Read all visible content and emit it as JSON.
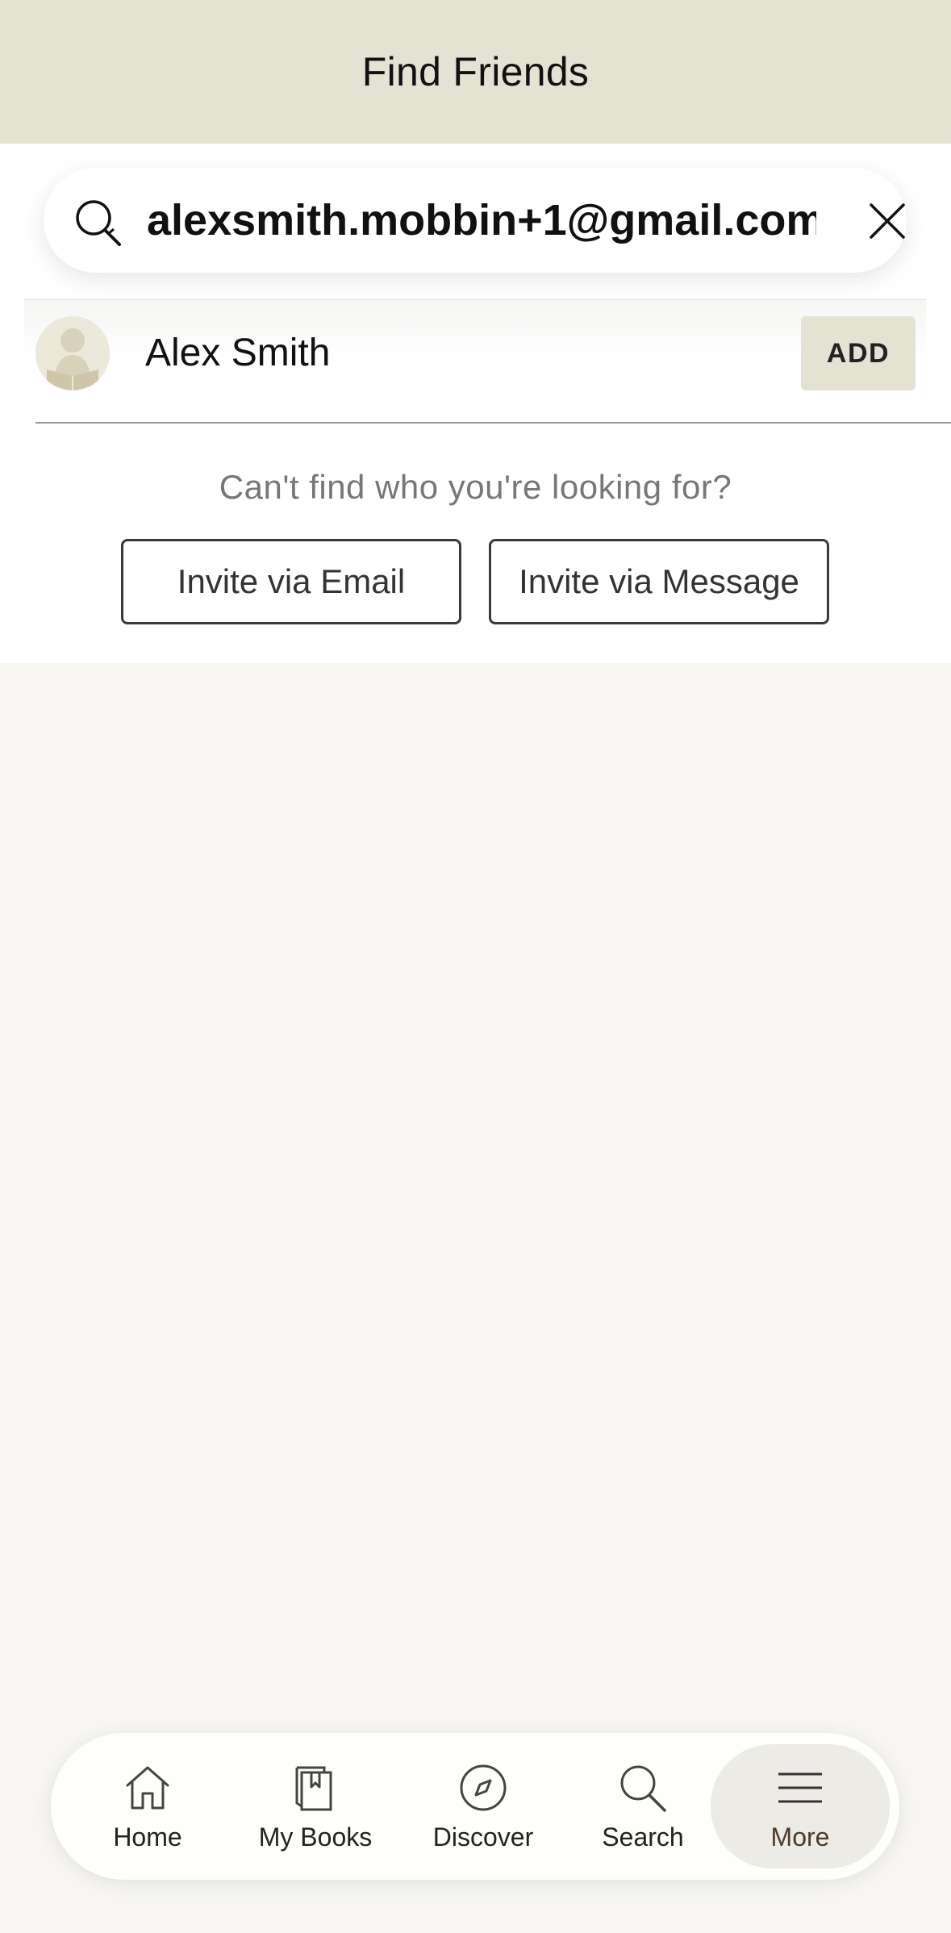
{
  "header": {
    "title": "Find Friends"
  },
  "search": {
    "value": "alexsmith.mobbin+1@gmail.com",
    "clear_icon": "close-icon",
    "search_icon": "search-icon"
  },
  "results": [
    {
      "name": "Alex Smith",
      "action_label": "ADD"
    }
  ],
  "invite": {
    "prompt": "Can't find who you're looking for?",
    "email_label": "Invite via Email",
    "message_label": "Invite via Message"
  },
  "tabs": [
    {
      "label": "Home",
      "icon": "home-icon"
    },
    {
      "label": "My Books",
      "icon": "books-icon"
    },
    {
      "label": "Discover",
      "icon": "compass-icon"
    },
    {
      "label": "Search",
      "icon": "search-icon"
    },
    {
      "label": "More",
      "icon": "menu-icon",
      "active": true
    }
  ],
  "colors": {
    "header_bg": "#e4e2d3",
    "page_bg": "#f7f6f2",
    "add_button_bg": "#e4e2d3",
    "active_tab_bg": "#ecebe6"
  }
}
